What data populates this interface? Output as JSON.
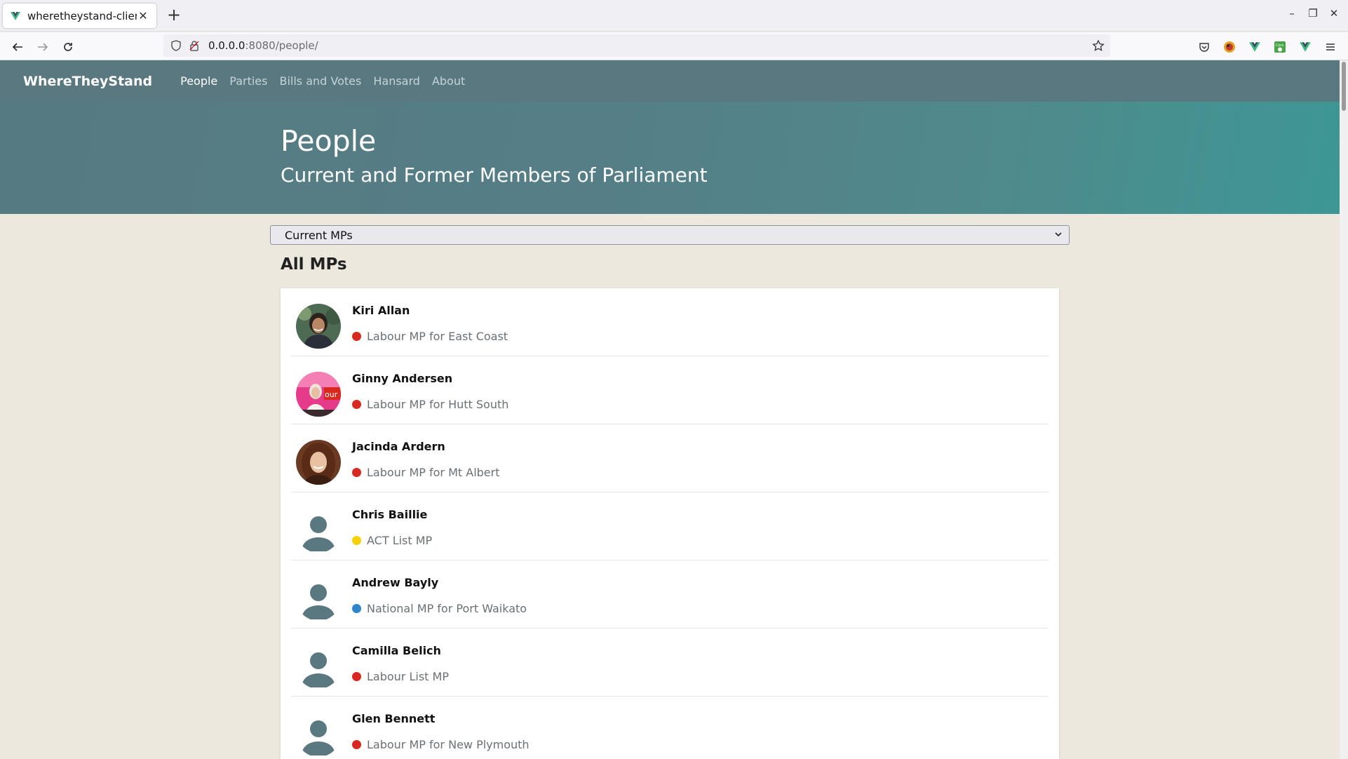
{
  "browser": {
    "tab_title": "wheretheystand-client",
    "url_host": "0.0.0.0",
    "url_path": ":8080/people/"
  },
  "site": {
    "brand": "WhereTheyStand",
    "nav": [
      {
        "label": "People",
        "active": true
      },
      {
        "label": "Parties",
        "active": false
      },
      {
        "label": "Bills and Votes",
        "active": false
      },
      {
        "label": "Hansard",
        "active": false
      },
      {
        "label": "About",
        "active": false
      }
    ]
  },
  "hero": {
    "title": "People",
    "subtitle": "Current and Former Members of Parliament"
  },
  "filter": {
    "selected": "Current MPs"
  },
  "section_title": "All MPs",
  "colors": {
    "labour": "#d8281f",
    "act": "#f6d10a",
    "national": "#2e86c9"
  },
  "mps": [
    {
      "name": "Kiri Allan",
      "role": "Labour MP for East Coast",
      "party": "labour",
      "avatar": "photo"
    },
    {
      "name": "Ginny Andersen",
      "role": "Labour MP for Hutt South",
      "party": "labour",
      "avatar": "photo"
    },
    {
      "name": "Jacinda Ardern",
      "role": "Labour MP for Mt Albert",
      "party": "labour",
      "avatar": "photo"
    },
    {
      "name": "Chris Baillie",
      "role": "ACT List MP",
      "party": "act",
      "avatar": "placeholder"
    },
    {
      "name": "Andrew Bayly",
      "role": "National MP for Port Waikato",
      "party": "national",
      "avatar": "placeholder"
    },
    {
      "name": "Camilla Belich",
      "role": "Labour List MP",
      "party": "labour",
      "avatar": "placeholder"
    },
    {
      "name": "Glen Bennett",
      "role": "Labour MP for New Plymouth",
      "party": "labour",
      "avatar": "placeholder"
    }
  ]
}
